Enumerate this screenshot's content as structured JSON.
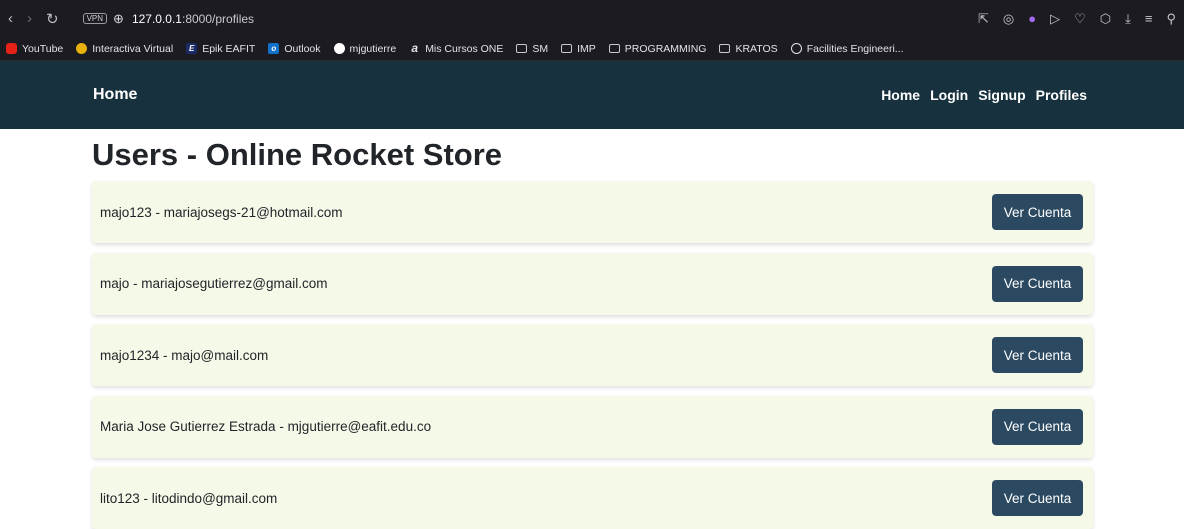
{
  "browser": {
    "url_host": "127.0.0.1",
    "url_path": ":8000/profiles",
    "vpn_label": "VPN",
    "bookmarks": [
      {
        "label": "YouTube",
        "icon": "youtube-icon"
      },
      {
        "label": "Interactiva Virtual",
        "icon": "interactiva-icon"
      },
      {
        "label": "Epik EAFIT",
        "icon": "epik-icon"
      },
      {
        "label": "Outlook",
        "icon": "outlook-icon"
      },
      {
        "label": "mjgutierre",
        "icon": "github-icon"
      },
      {
        "label": "Mis Cursos ONE",
        "icon": "a-icon"
      },
      {
        "label": "SM",
        "icon": "folder-icon"
      },
      {
        "label": "IMP",
        "icon": "folder-icon"
      },
      {
        "label": "PROGRAMMING",
        "icon": "folder-icon"
      },
      {
        "label": "KRATOS",
        "icon": "folder-icon"
      },
      {
        "label": "Facilities Engineeri...",
        "icon": "mercedes-icon"
      }
    ]
  },
  "navbar": {
    "brand": "Home",
    "links": [
      "Home",
      "Login",
      "Signup",
      "Profiles"
    ],
    "bg_color": "#17313f"
  },
  "main": {
    "title": "Users - Online Rocket Store",
    "users": [
      {
        "text": "majo123 - mariajosegs-21@hotmail.com",
        "button": "Ver Cuenta"
      },
      {
        "text": "majo - mariajosegutierrez@gmail.com",
        "button": "Ver Cuenta"
      },
      {
        "text": "majo1234 - majo@mail.com",
        "button": "Ver Cuenta"
      },
      {
        "text": "Maria Jose Gutierrez Estrada - mjgutierre@eafit.edu.co",
        "button": "Ver Cuenta"
      },
      {
        "text": "lito123 - litodindo@gmail.com",
        "button": "Ver Cuenta"
      }
    ],
    "card_color": "#f5f9e8",
    "button_color": "#2b4a61"
  }
}
